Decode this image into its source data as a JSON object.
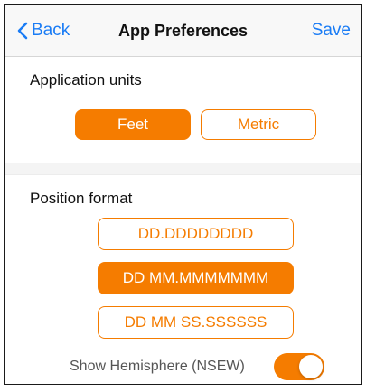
{
  "nav": {
    "back_label": "Back",
    "title": "App Preferences",
    "save_label": "Save"
  },
  "units": {
    "heading": "Application units",
    "options": [
      {
        "label": "Feet",
        "selected": true
      },
      {
        "label": "Metric",
        "selected": false
      }
    ]
  },
  "position_format": {
    "heading": "Position format",
    "options": [
      {
        "label": "DD.DDDDDDDD",
        "selected": false
      },
      {
        "label": "DD MM.MMMMMMM",
        "selected": true
      },
      {
        "label": "DD MM SS.SSSSSS",
        "selected": false
      }
    ]
  },
  "hemisphere": {
    "label": "Show Hemisphere (NSEW)",
    "enabled": true
  },
  "colors": {
    "accent": "#f57c00",
    "link": "#1a7cf5",
    "navbar_bg": "#f8f8f8",
    "separator_bg": "#f4f4f4"
  },
  "icons": {
    "back": "chevron-left-icon"
  }
}
